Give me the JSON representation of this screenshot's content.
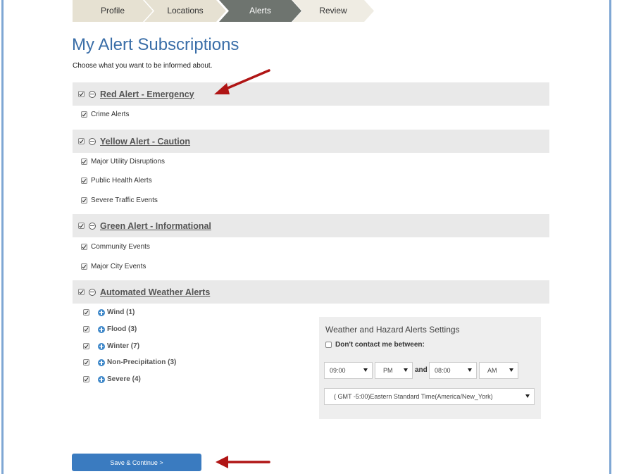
{
  "wizard": {
    "steps": [
      {
        "label": "Profile",
        "state": "done"
      },
      {
        "label": "Locations",
        "state": "done"
      },
      {
        "label": "Alerts",
        "state": "active"
      },
      {
        "label": "Review",
        "state": "todo"
      }
    ]
  },
  "page": {
    "title": "My Alert Subscriptions",
    "subtitle": "Choose what you want to be informed about."
  },
  "sections": [
    {
      "title": "Red Alert - Emergency",
      "checked": true,
      "items": [
        {
          "label": "Crime Alerts",
          "checked": true
        }
      ]
    },
    {
      "title": "Yellow Alert - Caution",
      "checked": true,
      "items": [
        {
          "label": "Major Utility Disruptions",
          "checked": true
        },
        {
          "label": "Public Health Alerts",
          "checked": true
        },
        {
          "label": "Severe Traffic Events",
          "checked": true
        }
      ]
    },
    {
      "title": "Green Alert - Informational",
      "checked": true,
      "items": [
        {
          "label": "Community Events",
          "checked": true
        },
        {
          "label": "Major City Events",
          "checked": true
        }
      ]
    },
    {
      "title": "Automated Weather Alerts",
      "checked": true,
      "items": [
        {
          "label": "Wind (1)",
          "checked": true
        },
        {
          "label": "Flood (3)",
          "checked": true
        },
        {
          "label": "Winter (7)",
          "checked": true
        },
        {
          "label": "Non-Precipitation (3)",
          "checked": true
        },
        {
          "label": "Severe (4)",
          "checked": true
        }
      ]
    }
  ],
  "weather_settings": {
    "title": "Weather and Hazard Alerts Settings",
    "dont_contact_label": "Don't contact me between:",
    "dont_contact_checked": false,
    "start_time": "09:00",
    "start_period": "PM",
    "and_label": "and",
    "end_time": "08:00",
    "end_period": "AM",
    "timezone": "( GMT -5:00)Eastern Standard Time(America/New_York)"
  },
  "actions": {
    "save_label": "Save & Continue >"
  },
  "colors": {
    "accent": "#3a7bc0",
    "title": "#3a6ea8",
    "annotation_arrow": "#b01515",
    "step_active": "#6e746f"
  }
}
